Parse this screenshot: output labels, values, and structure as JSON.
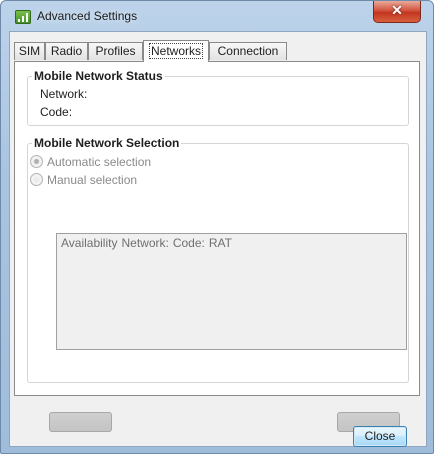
{
  "window": {
    "title": "Advanced Settings",
    "close_glyph": "✕"
  },
  "tabs": [
    {
      "label": "SIM",
      "active": false
    },
    {
      "label": "Radio",
      "active": false
    },
    {
      "label": "Profiles",
      "active": false
    },
    {
      "label": "Networks",
      "active": true
    },
    {
      "label": "Connection",
      "active": false
    }
  ],
  "status_group": {
    "title": "Mobile Network Status",
    "network_label": "Network:",
    "code_label": "Code:"
  },
  "selection_group": {
    "title": "Mobile Network Selection",
    "automatic_label": "Automatic selection",
    "automatic_checked": true,
    "manual_label": "Manual selection",
    "manual_checked": false,
    "list_columns": [
      "Availability",
      "Network:",
      "Code:",
      "RAT"
    ],
    "list_rows": []
  },
  "buttons": {
    "close_label": "Close"
  },
  "icons": {
    "app": "signal-bars-icon",
    "close": "close-icon"
  }
}
